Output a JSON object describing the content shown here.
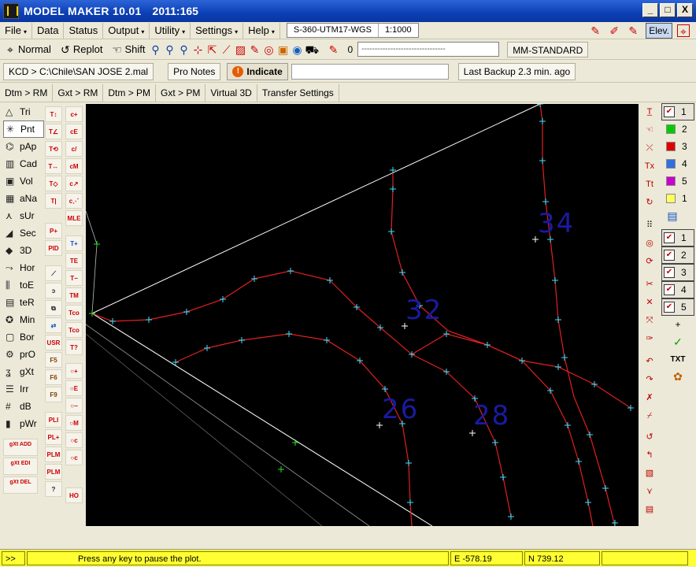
{
  "window": {
    "title": "MODEL MAKER  10.01",
    "build": "2011:165",
    "minimize": "_",
    "maximize": "□",
    "close": "X"
  },
  "menu": {
    "items": [
      {
        "label": "File",
        "arrow": "▾"
      },
      {
        "label": "Data",
        "arrow": ""
      },
      {
        "label": "Status",
        "arrow": ""
      },
      {
        "label": "Output",
        "arrow": "▾"
      },
      {
        "label": "Utility",
        "arrow": "▾"
      },
      {
        "label": "Settings",
        "arrow": "▾"
      },
      {
        "label": "Help",
        "arrow": "▾"
      }
    ],
    "projection": "S-360-UTM17-WGS",
    "scale": "1:1000",
    "elev_button": "Elev."
  },
  "toolbar2": {
    "normal": "Normal",
    "replot": "Replot",
    "shift": "Shift",
    "pen_value": "0",
    "line_sample": "--------------------------------",
    "style": "MM-STANDARD"
  },
  "toolbar3": {
    "kcd": "KCD > C:\\Chile\\SAN JOSE 2.mal",
    "pro_notes": "Pro Notes",
    "indicate": "Indicate",
    "last_backup": "Last Backup 2.3 min. ago"
  },
  "toolbar4": {
    "items": [
      "Dtm > RM",
      "Gxt > RM",
      "Dtm > PM",
      "Gxt > PM",
      "Virtual 3D",
      "Transfer Settings"
    ]
  },
  "left_palette": {
    "items": [
      {
        "label": "Tri",
        "icon": "△"
      },
      {
        "label": "Pnt",
        "icon": "✳"
      },
      {
        "label": "pAp",
        "icon": "⌬"
      },
      {
        "label": "Cad",
        "icon": "▥"
      },
      {
        "label": "Vol",
        "icon": "▣"
      },
      {
        "label": "aNa",
        "icon": "▦"
      },
      {
        "label": "sUr",
        "icon": "⋏"
      },
      {
        "label": "Sec",
        "icon": "◢"
      },
      {
        "label": "3D",
        "icon": "◆"
      },
      {
        "label": "Hor",
        "icon": "⤳"
      },
      {
        "label": "toE",
        "icon": "⫼"
      },
      {
        "label": "teR",
        "icon": "▤"
      },
      {
        "label": "Min",
        "icon": "✪"
      },
      {
        "label": "Bor",
        "icon": "▢"
      },
      {
        "label": "prO",
        "icon": "⚙"
      },
      {
        "label": "gXt",
        "icon": "ʓ"
      },
      {
        "label": "Irr",
        "icon": "☰"
      },
      {
        "label": "dB",
        "icon": "#"
      },
      {
        "label": "pWr",
        "icon": "▮"
      }
    ],
    "gxt_add": "gXt ADD",
    "gxt_edi": "gXt EDI",
    "gxt_del": "gXt DEL"
  },
  "layers": {
    "colored": [
      {
        "label": "1",
        "color": "#f0e000",
        "checked": true
      },
      {
        "label": "2",
        "color": "#00cc00",
        "checked": false
      },
      {
        "label": "3",
        "color": "#e00000",
        "checked": false
      },
      {
        "label": "4",
        "color": "#3070e0",
        "checked": false
      },
      {
        "label": "5",
        "color": "#cc00cc",
        "checked": false
      },
      {
        "label": "1",
        "color": "#ffff60",
        "checked": false
      }
    ],
    "checked": [
      "1",
      "2",
      "3",
      "4",
      "5"
    ],
    "add": "+"
  },
  "canvas": {
    "labels": [
      {
        "text": "34"
      },
      {
        "text": "32"
      },
      {
        "text": "26"
      },
      {
        "text": "28"
      }
    ]
  },
  "status": {
    "prompt": ">>",
    "message": "Press any key to pause the plot.",
    "easting": "E -578.19",
    "northing": "N 739.12"
  }
}
